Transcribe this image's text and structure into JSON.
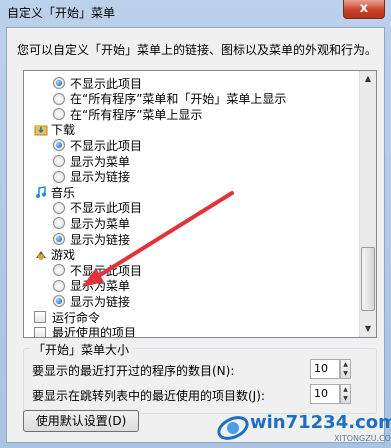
{
  "window": {
    "title": "自定义「开始」菜单",
    "close_glyph": "x"
  },
  "description": "您可以自定义「开始」菜单上的链接、图标以及菜单的外观和行为。",
  "list": {
    "rows": [
      {
        "kind": "radio",
        "label": "不显示此项目",
        "checked": true
      },
      {
        "kind": "radio",
        "label": "在“所有程序”菜单和「开始」菜单上显示",
        "checked": false
      },
      {
        "kind": "radio",
        "label": "在“所有程序”菜单上显示",
        "checked": false
      },
      {
        "kind": "category",
        "label": "下载",
        "icon": "folder-download-icon"
      },
      {
        "kind": "radio",
        "label": "不显示此项目",
        "checked": true
      },
      {
        "kind": "radio",
        "label": "显示为菜单",
        "checked": false
      },
      {
        "kind": "radio",
        "label": "显示为链接",
        "checked": false
      },
      {
        "kind": "category",
        "label": "音乐",
        "icon": "music-note-icon"
      },
      {
        "kind": "radio",
        "label": "不显示此项目",
        "checked": false
      },
      {
        "kind": "radio",
        "label": "显示为菜单",
        "checked": false
      },
      {
        "kind": "radio",
        "label": "显示为链接",
        "checked": true
      },
      {
        "kind": "category",
        "label": "游戏",
        "icon": "games-icon"
      },
      {
        "kind": "radio",
        "label": "不显示此项目",
        "checked": false
      },
      {
        "kind": "radio",
        "label": "显示为菜单",
        "checked": false
      },
      {
        "kind": "radio",
        "label": "显示为链接",
        "checked": true
      },
      {
        "kind": "check",
        "label": "运行命令",
        "checked": false
      },
      {
        "kind": "check",
        "label": "最近使用的项目",
        "checked": false
      }
    ]
  },
  "size_group": {
    "legend": "「开始」菜单大小",
    "recent_programs_label": "要显示的最近打开过的程序的数目(N):",
    "recent_programs_value": "10",
    "jumplist_label": "要显示在跳转列表中的最近使用的项目数(J):",
    "jumplist_value": "10"
  },
  "buttons": {
    "defaults": "使用默认设置(D)"
  },
  "watermark": {
    "text": "win71234.com",
    "sub": "XITONGZU.COM"
  },
  "colors": {
    "arrow": "#e0343c",
    "accent": "#1d6fc4"
  }
}
